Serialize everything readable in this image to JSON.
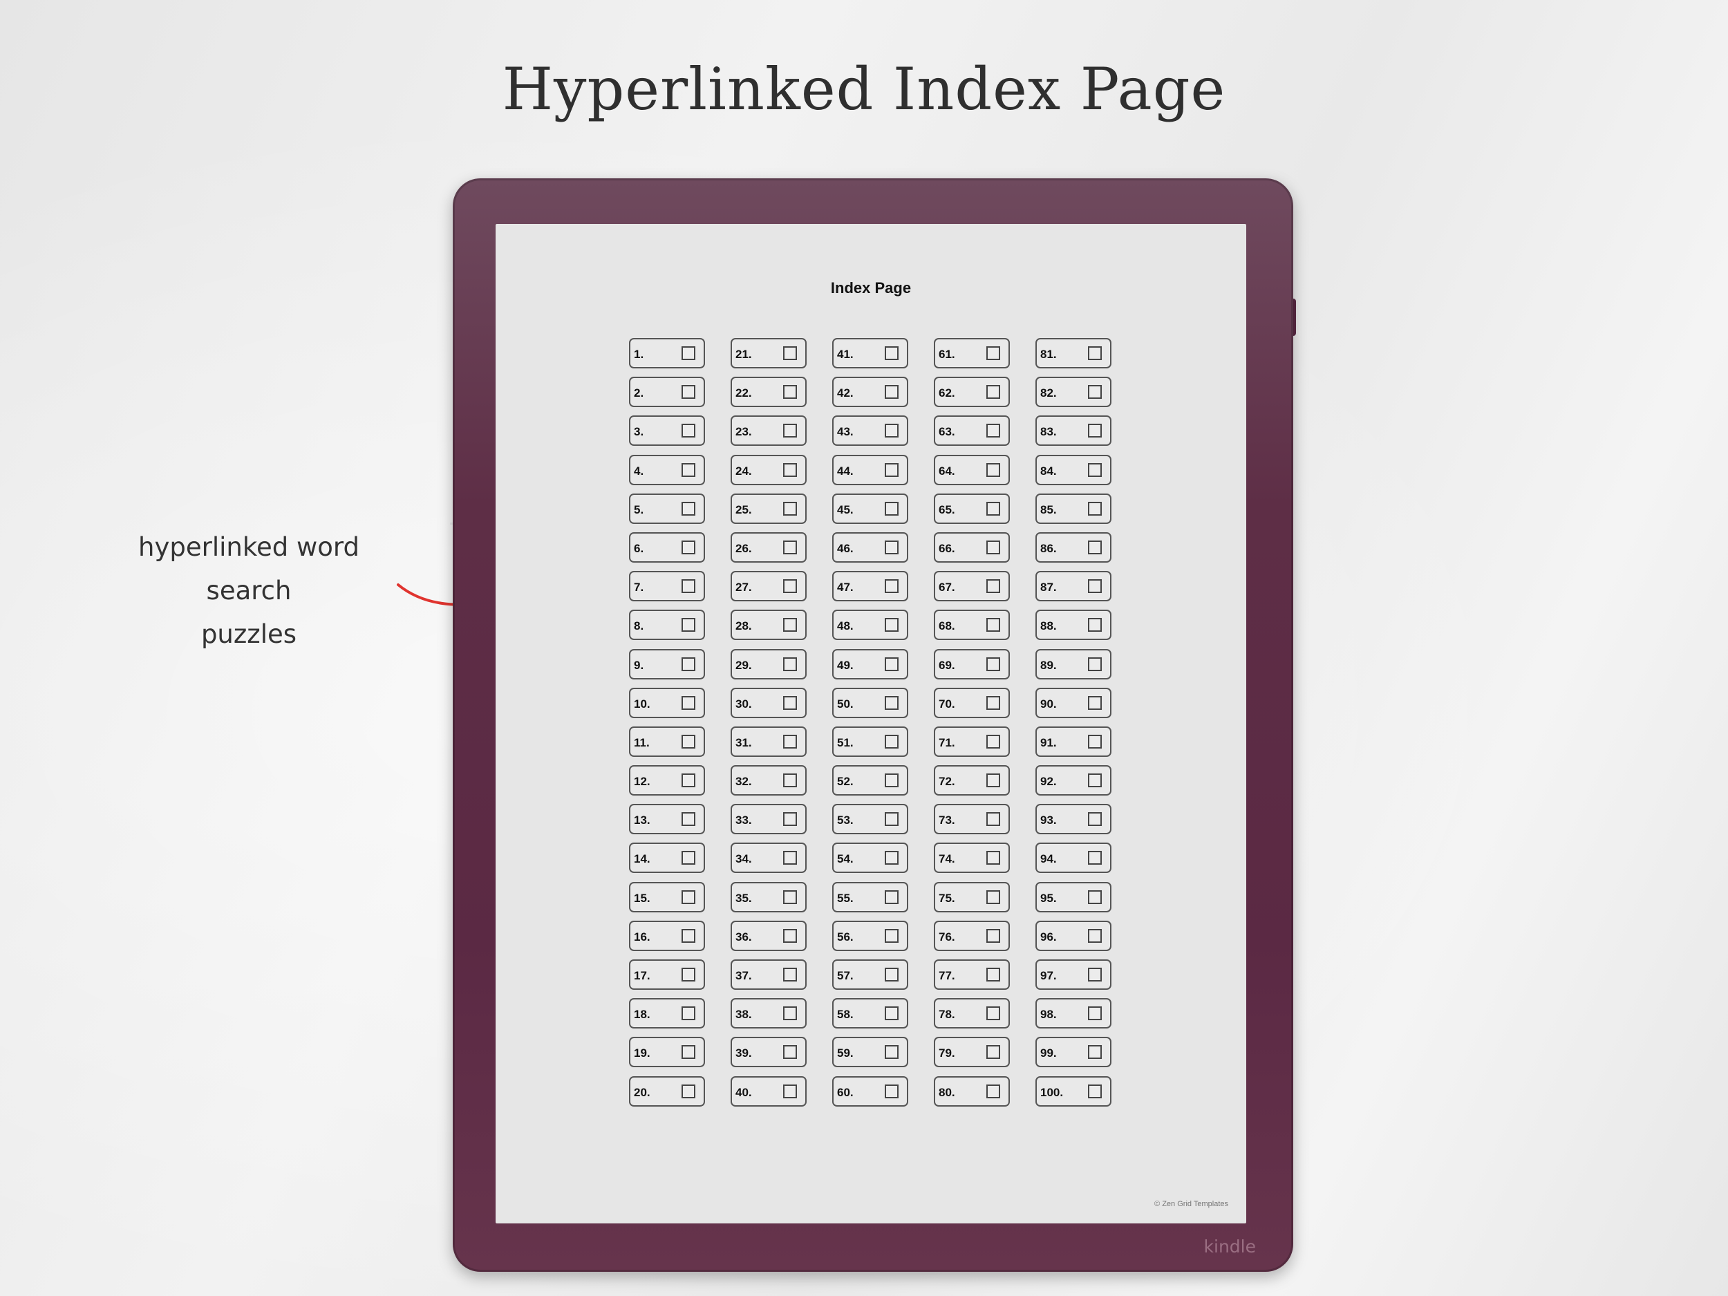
{
  "header": {
    "title": "Hyperlinked Index Page"
  },
  "annotation": {
    "line1": "hyperlinked word search",
    "line2": "puzzles"
  },
  "device": {
    "brand": "kindle",
    "accent": "#5b2944"
  },
  "screen": {
    "title": "Index Page",
    "copyright": "© Zen Grid Templates",
    "items": [
      "1.",
      "2.",
      "3.",
      "4.",
      "5.",
      "6.",
      "7.",
      "8.",
      "9.",
      "10.",
      "11.",
      "12.",
      "13.",
      "14.",
      "15.",
      "16.",
      "17.",
      "18.",
      "19.",
      "20.",
      "21.",
      "22.",
      "23.",
      "24.",
      "25.",
      "26.",
      "27.",
      "28.",
      "29.",
      "30.",
      "31.",
      "32.",
      "33.",
      "34.",
      "35.",
      "36.",
      "37.",
      "38.",
      "39.",
      "40.",
      "41.",
      "42.",
      "43.",
      "44.",
      "45.",
      "46.",
      "47.",
      "48.",
      "49.",
      "50.",
      "51.",
      "52.",
      "53.",
      "54.",
      "55.",
      "56.",
      "57.",
      "58.",
      "59.",
      "60.",
      "61.",
      "62.",
      "63.",
      "64.",
      "65.",
      "66.",
      "67.",
      "68.",
      "69.",
      "70.",
      "71.",
      "72.",
      "73.",
      "74.",
      "75.",
      "76.",
      "77.",
      "78.",
      "79.",
      "80.",
      "81.",
      "82.",
      "83.",
      "84.",
      "85.",
      "86.",
      "87.",
      "88.",
      "89.",
      "90.",
      "91.",
      "92.",
      "93.",
      "94.",
      "95.",
      "96.",
      "97.",
      "98.",
      "99.",
      "100."
    ]
  }
}
